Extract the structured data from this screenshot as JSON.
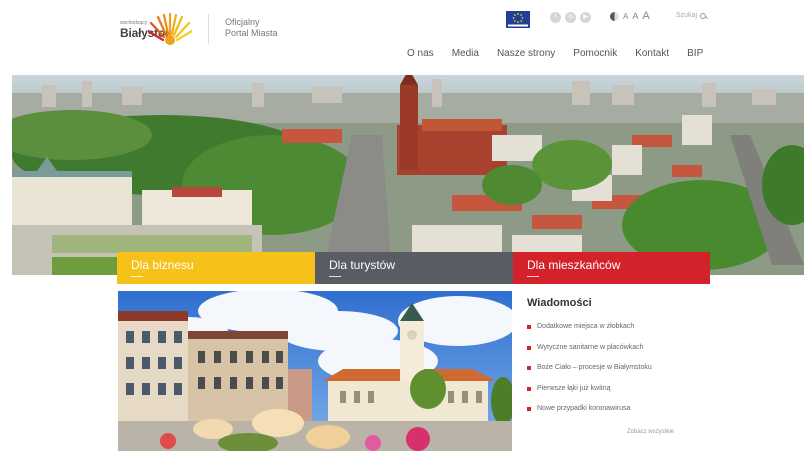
{
  "header": {
    "logo_small": "wschodzący",
    "logo_city": "Białystok",
    "portal_line1": "Oficjalny",
    "portal_line2": "Portal Miasta",
    "search_label": "Szukaj",
    "font_sizes": [
      "A",
      "A",
      "A"
    ]
  },
  "nav": {
    "items": [
      {
        "label": "O nas"
      },
      {
        "label": "Media"
      },
      {
        "label": "Nasze strony"
      },
      {
        "label": "Pomocnik"
      },
      {
        "label": "Kontakt"
      },
      {
        "label": "BIP"
      }
    ]
  },
  "categories": [
    {
      "label": "Dla biznesu",
      "color": "#f6c21a"
    },
    {
      "label": "Dla turystów",
      "color": "#595d63"
    },
    {
      "label": "Dla mieszkańców",
      "color": "#d4222a"
    }
  ],
  "news": {
    "title": "Wiadomości",
    "items": [
      {
        "label": "Dodatkowe miejsca w żłobkach"
      },
      {
        "label": "Wytyczne sanitarne w placówkach"
      },
      {
        "label": "Boże Ciało – procesje w Białymstoku"
      },
      {
        "label": "Pierwsze łąki już kwitną"
      },
      {
        "label": "Nowe przypadki koronawirusa"
      }
    ],
    "more_label": "Zobacz wszystkie",
    "bullet_color": "#d4222a"
  },
  "icons": [
    "sun-logo-icon",
    "eu-flag-icon",
    "facebook-icon",
    "instagram-icon",
    "youtube-icon",
    "contrast-icon",
    "search-icon"
  ]
}
